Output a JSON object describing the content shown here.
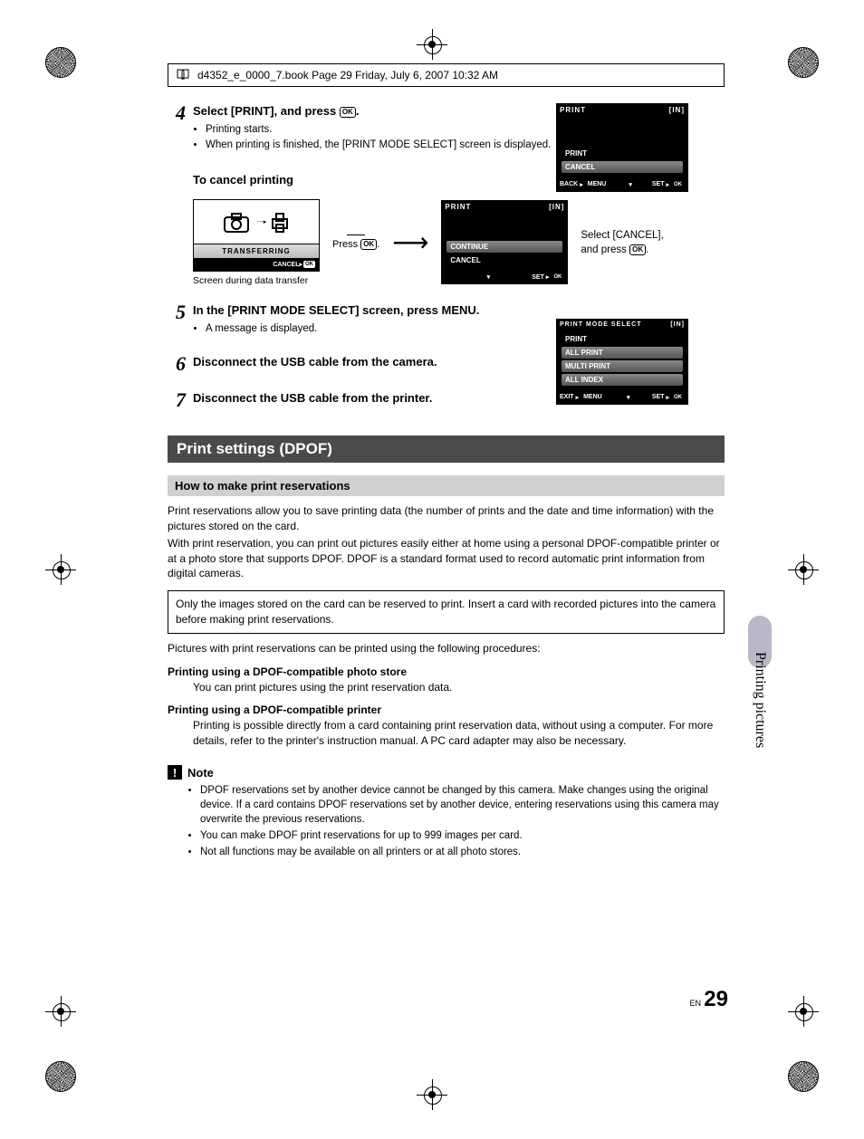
{
  "header": {
    "text": "d4352_e_0000_7.book  Page 29  Friday, July 6, 2007  10:32 AM"
  },
  "step4": {
    "num": "4",
    "title_a": "Select [PRINT], and press ",
    "title_b": ".",
    "ok": "OK",
    "b1": "Printing starts.",
    "b2": "When printing is finished, the [PRINT MODE SELECT] screen is displayed."
  },
  "lcd_print": {
    "title": "PRINT",
    "in": "[IN]",
    "r1": "PRINT",
    "r2": "CANCEL",
    "back": "BACK",
    "menu": "MENU",
    "set": "SET",
    "ok": "OK"
  },
  "cancel": {
    "head": "To cancel printing",
    "transfer": "TRANSFERRING",
    "cancel_lbl": "CANCEL",
    "ok": "OK",
    "press": "Press ",
    "press2": ".",
    "cap": "Screen during data transfer",
    "lcd2_title": "PRINT",
    "lcd2_in": "[IN]",
    "lcd2_r1": "CONTINUE",
    "lcd2_r2": "CANCEL",
    "lcd2_set": "SET",
    "lcd2_ok": "OK",
    "right1": "Select [CANCEL], and press ",
    "right2": "."
  },
  "step5": {
    "num": "5",
    "title": "In the [PRINT MODE SELECT] screen, press MENU.",
    "b1": "A message is displayed."
  },
  "step6": {
    "num": "6",
    "title": "Disconnect the USB cable from the camera."
  },
  "step7": {
    "num": "7",
    "title": "Disconnect the USB cable from the printer."
  },
  "lcd_mode": {
    "title": "PRINT MODE SELECT",
    "in": "[IN]",
    "r1": "PRINT",
    "r2": "ALL PRINT",
    "r3": "MULTI PRINT",
    "r4": "ALL INDEX",
    "exit": "EXIT",
    "menu": "MENU",
    "set": "SET",
    "ok": "OK"
  },
  "section": {
    "title": "Print settings (DPOF)"
  },
  "sub": {
    "title": "How to make print reservations"
  },
  "p1": "Print reservations allow you to save printing data (the number of prints and the date and time information) with the pictures stored on the card.",
  "p2": "With print reservation, you can print out pictures easily either at home using a personal DPOF-compatible printer or at a photo store that supports DPOF. DPOF is a standard format used to record automatic print information from digital cameras.",
  "box": "Only the images stored on the card can be reserved to print. Insert a card with recorded pictures into the camera before making print reservations.",
  "p3": "Pictures with print reservations can be printed using the following procedures:",
  "proc1h": "Printing using a DPOF-compatible photo store",
  "proc1b": "You can print pictures using the print reservation data.",
  "proc2h": "Printing using a DPOF-compatible printer",
  "proc2b": "Printing is possible directly from a card containing print reservation data, without using a computer. For more details, refer to the printer's instruction manual. A PC card adapter may also be necessary.",
  "note": {
    "title": "Note",
    "n1": "DPOF reservations set by another device cannot be changed by this camera. Make changes using the original device. If a card contains DPOF reservations set by another device, entering reservations using this camera may overwrite the previous reservations.",
    "n2": "You can make DPOF print reservations for up to 999 images per card.",
    "n3": "Not all functions may be available on all printers or at all photo stores."
  },
  "side": "Printing pictures",
  "page": {
    "lang": "EN",
    "num": "29"
  }
}
